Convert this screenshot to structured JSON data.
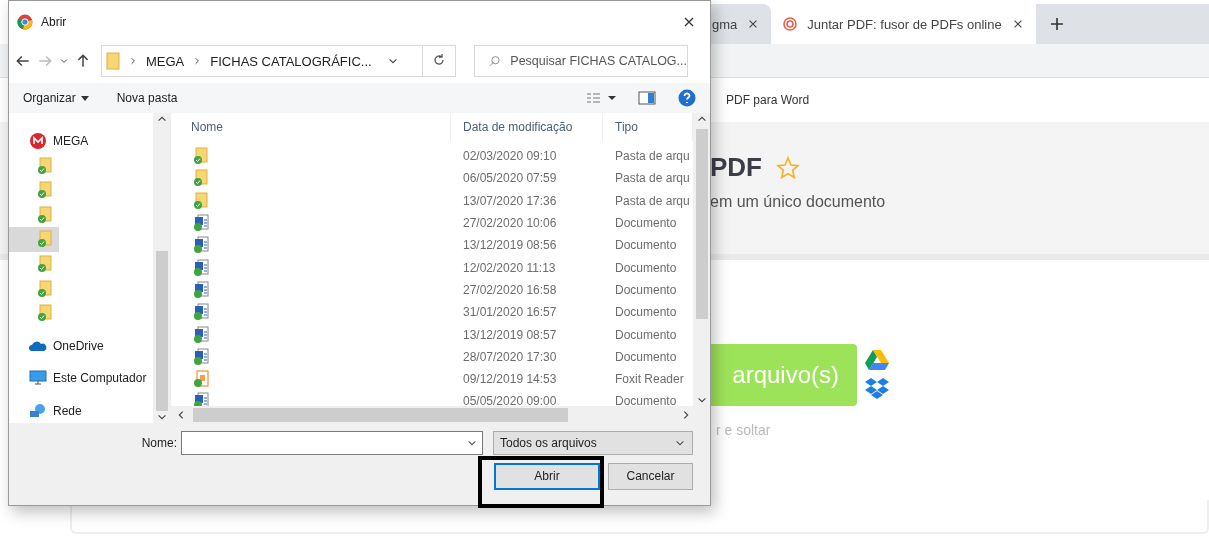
{
  "browser": {
    "tabs": [
      {
        "label": "gma",
        "selected": false
      },
      {
        "label": "Juntar PDF: fusor de PDFs online",
        "selected": true
      }
    ],
    "nav_link": "PDF para Word",
    "hero_title": "PDF",
    "hero_subtitle": "em um único documento",
    "upload_button": "arquivo(s)",
    "drop_hint": "r e soltar"
  },
  "dialog": {
    "title": "Abrir",
    "breadcrumbs": [
      "MEGA",
      "FICHAS CATALOGRÁFIC..."
    ],
    "search": {
      "placeholder": "Pesquisar FICHAS CATALOG..."
    },
    "toolbar": [
      "Organizar",
      "Nova pasta"
    ],
    "nav_items": [
      {
        "kind": "mega",
        "label": "MEGA",
        "selected": false
      },
      {
        "kind": "folder",
        "selected": false
      },
      {
        "kind": "folder",
        "selected": false
      },
      {
        "kind": "folder",
        "selected": false
      },
      {
        "kind": "folder",
        "selected": true
      },
      {
        "kind": "folder",
        "selected": false
      },
      {
        "kind": "folder",
        "selected": false
      },
      {
        "kind": "folder",
        "selected": false
      },
      {
        "kind": "cloud",
        "label": "OneDrive",
        "selected": false
      },
      {
        "kind": "computer",
        "label": "Este Computador",
        "selected": false
      },
      {
        "kind": "network",
        "label": "Rede",
        "selected": false
      }
    ],
    "columns": [
      "Nome",
      "Data de modificação",
      "Tipo"
    ],
    "rows": [
      {
        "kind": "folder",
        "date": "02/03/2020 09:10",
        "type": "Pasta de arqu"
      },
      {
        "kind": "folder",
        "date": "06/05/2020 07:59",
        "type": "Pasta de arqu"
      },
      {
        "kind": "folder",
        "date": "13/07/2020 17:36",
        "type": "Pasta de arqu"
      },
      {
        "kind": "doc",
        "date": "27/02/2020 10:06",
        "type": "Documento"
      },
      {
        "kind": "doc",
        "date": "13/12/2019 08:56",
        "type": "Documento"
      },
      {
        "kind": "doc",
        "date": "12/02/2020 11:13",
        "type": "Documento"
      },
      {
        "kind": "doc",
        "date": "27/02/2020 16:58",
        "type": "Documento"
      },
      {
        "kind": "doc",
        "date": "31/01/2020 16:57",
        "type": "Documento"
      },
      {
        "kind": "doc",
        "date": "13/12/2019 08:57",
        "type": "Documento"
      },
      {
        "kind": "doc",
        "date": "28/07/2020 17:30",
        "type": "Documento"
      },
      {
        "kind": "pdf",
        "date": "09/12/2019 14:53",
        "type": "Foxit Reader"
      },
      {
        "kind": "doc",
        "date": "05/05/2020 09:00",
        "type": "Documento"
      }
    ],
    "name_label": "Nome:",
    "file_type": "Todos os arquivos",
    "buttons": [
      {
        "label": "Abrir",
        "kind": "primary"
      },
      {
        "label": "Cancelar",
        "kind": "secondary"
      }
    ]
  }
}
